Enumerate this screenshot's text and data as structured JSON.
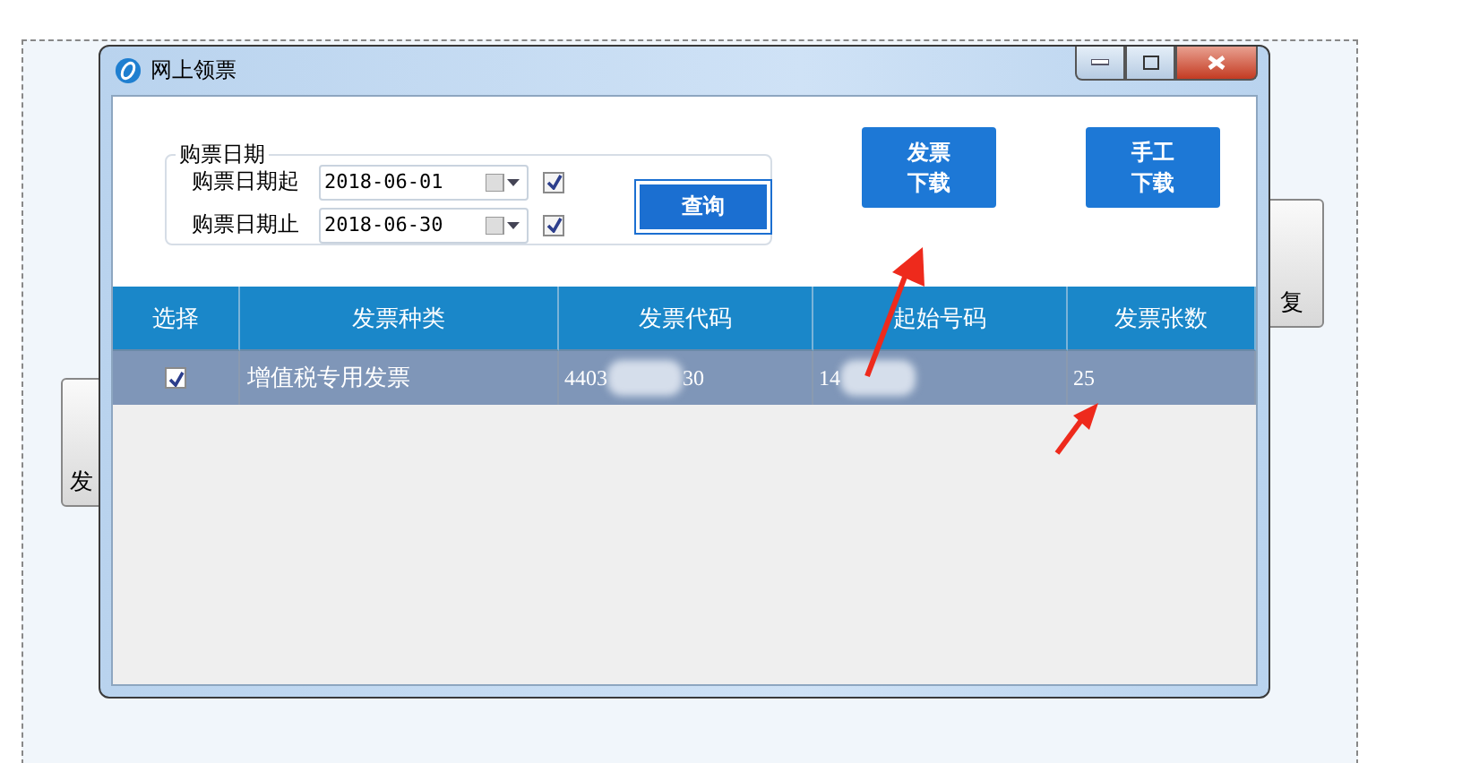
{
  "desktop": {
    "tiles": [
      {
        "label": "发"
      },
      {
        "label": "复"
      }
    ]
  },
  "window": {
    "title": "网上领票"
  },
  "filter": {
    "legend": "购票日期",
    "rows": [
      {
        "label": "购票日期起",
        "value": "2018-06-01",
        "checked": true
      },
      {
        "label": "购票日期止",
        "value": "2018-06-30",
        "checked": true
      }
    ],
    "query_button": "查询"
  },
  "actions": [
    {
      "line1": "发票",
      "line2": "下载"
    },
    {
      "line1": "手工",
      "line2": "下载"
    }
  ],
  "table": {
    "columns": [
      "选择",
      "发票种类",
      "发票代码",
      "起始号码",
      "发票张数"
    ],
    "rows": [
      {
        "checked": true,
        "selected": true,
        "type": "增值税专用发票",
        "code": [
          "4403",
          "30"
        ],
        "start": [
          "14"
        ],
        "count": "25"
      }
    ]
  }
}
